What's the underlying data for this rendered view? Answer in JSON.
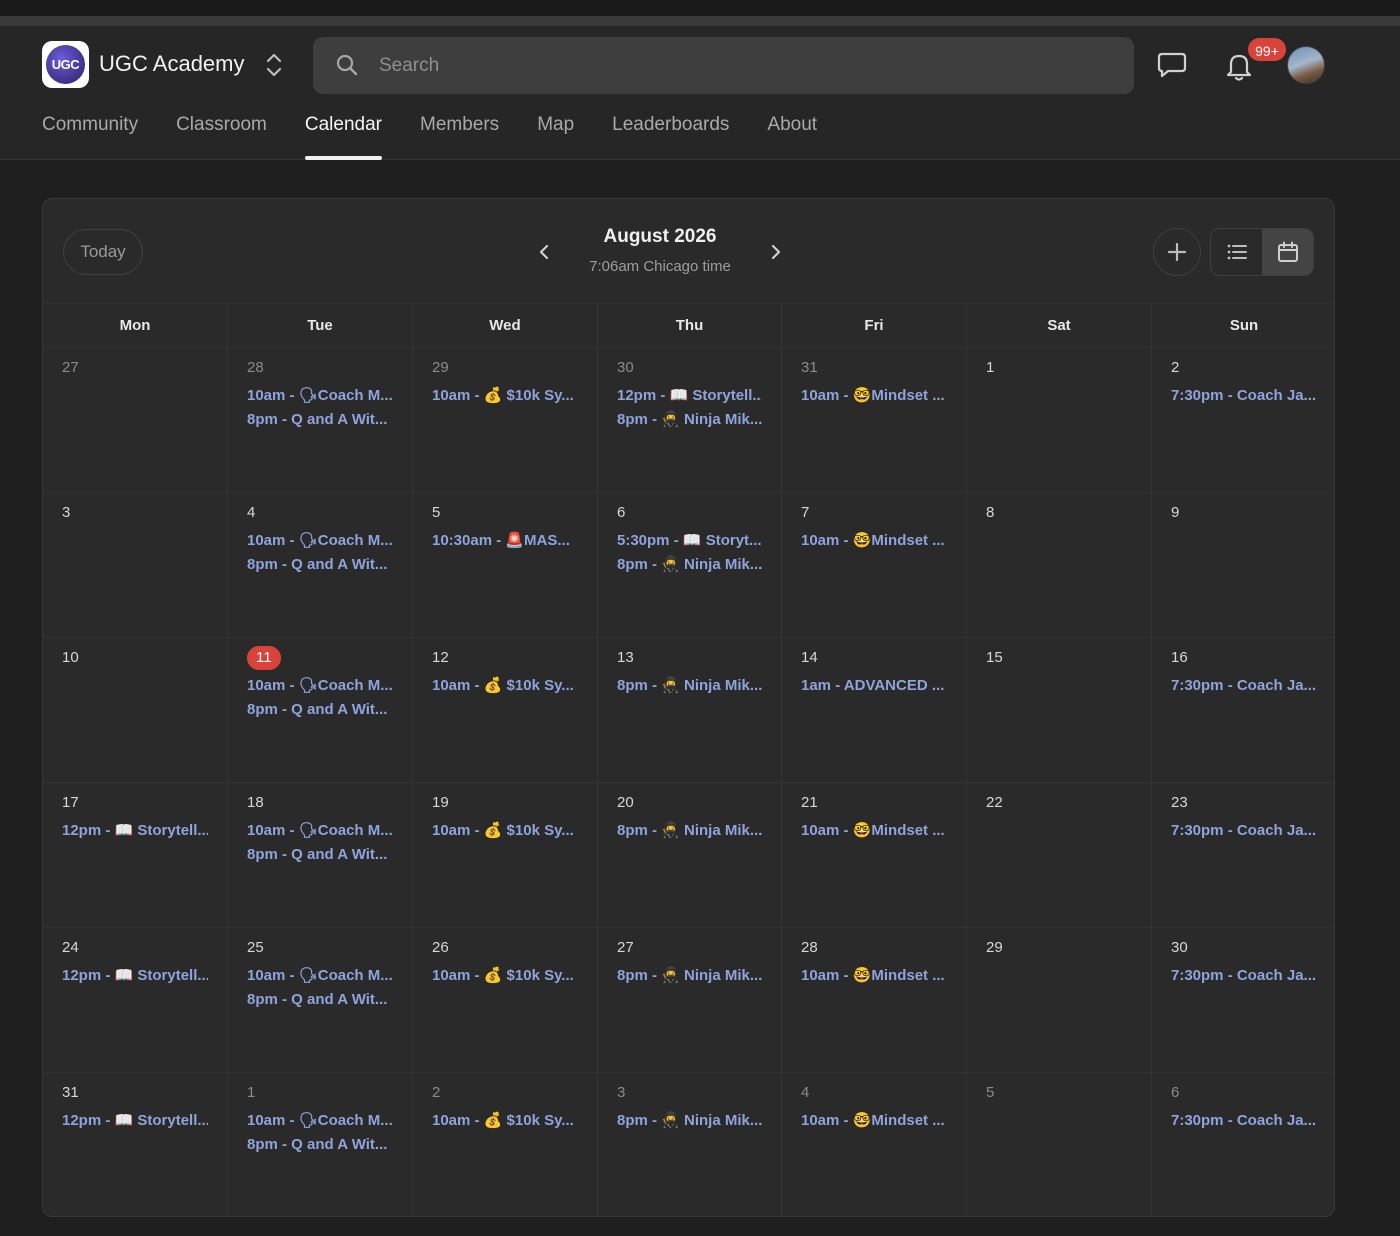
{
  "app": {
    "name": "UGC Academy",
    "logo_text": "UGC"
  },
  "search": {
    "placeholder": "Search"
  },
  "notifications": {
    "badge": "99+"
  },
  "nav": {
    "tabs": [
      "Community",
      "Classroom",
      "Calendar",
      "Members",
      "Map",
      "Leaderboards",
      "About"
    ],
    "active": "Calendar"
  },
  "calendar": {
    "today_label": "Today",
    "month": "August 2026",
    "time_note": "7:06am Chicago time",
    "weekdays": [
      "Mon",
      "Tue",
      "Wed",
      "Thu",
      "Fri",
      "Sat",
      "Sun"
    ],
    "weeks": [
      [
        {
          "d": "27",
          "dim": true,
          "ev": []
        },
        {
          "d": "28",
          "dim": true,
          "ev": [
            "10am - 🗣Coach M...",
            "8pm - Q and A Wit..."
          ]
        },
        {
          "d": "29",
          "dim": true,
          "ev": [
            "10am - 💰 $10k Sy..."
          ]
        },
        {
          "d": "30",
          "dim": true,
          "ev": [
            "12pm - 📖 Storytell...",
            "8pm - 🥷 Ninja Mik..."
          ]
        },
        {
          "d": "31",
          "dim": true,
          "ev": [
            "10am - 🤓Mindset ..."
          ]
        },
        {
          "d": "1",
          "ev": []
        },
        {
          "d": "2",
          "ev": [
            "7:30pm - Coach Ja..."
          ]
        }
      ],
      [
        {
          "d": "3",
          "ev": []
        },
        {
          "d": "4",
          "ev": [
            "10am - 🗣Coach M...",
            "8pm - Q and A Wit..."
          ]
        },
        {
          "d": "5",
          "ev": [
            "10:30am - 🚨MAS..."
          ]
        },
        {
          "d": "6",
          "ev": [
            "5:30pm - 📖 Storyt...",
            "8pm - 🥷 Ninja Mik..."
          ]
        },
        {
          "d": "7",
          "ev": [
            "10am - 🤓Mindset ..."
          ]
        },
        {
          "d": "8",
          "ev": []
        },
        {
          "d": "9",
          "ev": []
        }
      ],
      [
        {
          "d": "10",
          "ev": []
        },
        {
          "d": "11",
          "today": true,
          "ev": [
            "10am - 🗣Coach M...",
            "8pm - Q and A Wit..."
          ]
        },
        {
          "d": "12",
          "ev": [
            "10am - 💰 $10k Sy..."
          ]
        },
        {
          "d": "13",
          "ev": [
            "8pm - 🥷 Ninja Mik..."
          ]
        },
        {
          "d": "14",
          "ev": [
            "1am - ADVANCED ..."
          ]
        },
        {
          "d": "15",
          "ev": []
        },
        {
          "d": "16",
          "ev": [
            "7:30pm - Coach Ja..."
          ]
        }
      ],
      [
        {
          "d": "17",
          "ev": [
            "12pm - 📖 Storytell..."
          ]
        },
        {
          "d": "18",
          "ev": [
            "10am - 🗣Coach M...",
            "8pm - Q and A Wit..."
          ]
        },
        {
          "d": "19",
          "ev": [
            "10am - 💰 $10k Sy..."
          ]
        },
        {
          "d": "20",
          "ev": [
            "8pm - 🥷 Ninja Mik..."
          ]
        },
        {
          "d": "21",
          "ev": [
            "10am - 🤓Mindset ..."
          ]
        },
        {
          "d": "22",
          "ev": []
        },
        {
          "d": "23",
          "ev": [
            "7:30pm - Coach Ja..."
          ]
        }
      ],
      [
        {
          "d": "24",
          "ev": [
            "12pm - 📖 Storytell..."
          ]
        },
        {
          "d": "25",
          "ev": [
            "10am - 🗣Coach M...",
            "8pm - Q and A Wit..."
          ]
        },
        {
          "d": "26",
          "ev": [
            "10am - 💰 $10k Sy..."
          ]
        },
        {
          "d": "27",
          "ev": [
            "8pm - 🥷 Ninja Mik..."
          ]
        },
        {
          "d": "28",
          "ev": [
            "10am - 🤓Mindset ..."
          ]
        },
        {
          "d": "29",
          "ev": []
        },
        {
          "d": "30",
          "ev": [
            "7:30pm - Coach Ja..."
          ]
        }
      ],
      [
        {
          "d": "31",
          "ev": [
            "12pm - 📖 Storytell..."
          ]
        },
        {
          "d": "1",
          "dim": true,
          "ev": [
            "10am - 🗣Coach M...",
            "8pm - Q and A Wit..."
          ]
        },
        {
          "d": "2",
          "dim": true,
          "ev": [
            "10am - 💰 $10k Sy..."
          ]
        },
        {
          "d": "3",
          "dim": true,
          "ev": [
            "8pm - 🥷 Ninja Mik..."
          ]
        },
        {
          "d": "4",
          "dim": true,
          "ev": [
            "10am - 🤓Mindset ..."
          ]
        },
        {
          "d": "5",
          "dim": true,
          "ev": []
        },
        {
          "d": "6",
          "dim": true,
          "ev": [
            "7:30pm - Coach Ja..."
          ]
        }
      ]
    ]
  },
  "colors": {
    "accent": "#d9443a",
    "event": "#8fa3dc",
    "panel": "#2a2a2a",
    "header": "#262626"
  }
}
